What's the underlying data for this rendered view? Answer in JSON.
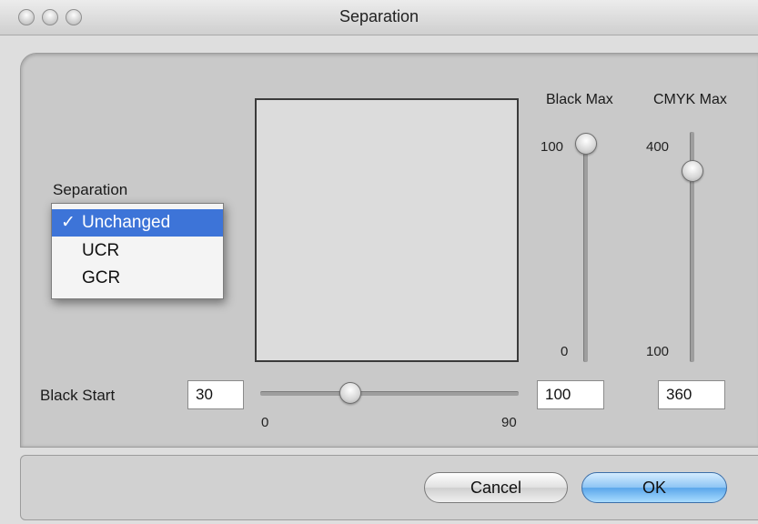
{
  "window": {
    "title": "Separation"
  },
  "separation": {
    "label": "Separation",
    "options": [
      "Unchanged",
      "UCR",
      "GCR"
    ],
    "selected": "Unchanged",
    "check_mark": "✓"
  },
  "black_start": {
    "label": "Black Start",
    "value": "30",
    "slider_min": "0",
    "slider_max": "90",
    "slider_level": 30
  },
  "black_max": {
    "label": "Black Max",
    "value": "100",
    "top_tick": "100",
    "bottom_tick": "0",
    "slider_level": 100
  },
  "cmyk_max": {
    "label": "CMYK Max",
    "value": "360",
    "top_tick": "400",
    "bottom_tick": "100",
    "slider_level": 360
  },
  "buttons": {
    "cancel": "Cancel",
    "ok": "OK"
  },
  "colors": {
    "selection": "#3d74d8",
    "default_button": "#5aa6ea"
  }
}
